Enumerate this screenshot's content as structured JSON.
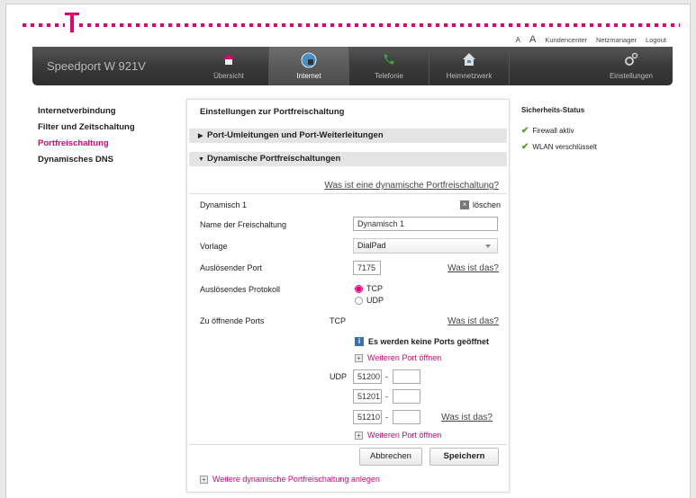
{
  "top": {
    "font_small": "A",
    "font_large": "A",
    "links": [
      "Kundencenter",
      "Netzmanager",
      "Logout"
    ]
  },
  "nav": {
    "brand": "Speedport W 921V",
    "tabs": [
      {
        "label": "Übersicht",
        "icon": "home-icon"
      },
      {
        "label": "Internet",
        "icon": "globe-icon",
        "active": true
      },
      {
        "label": "Telefonie",
        "icon": "phone-icon"
      },
      {
        "label": "Heimnetzwerk",
        "icon": "house-network-icon"
      },
      {
        "label": "Einstellungen",
        "icon": "gears-icon"
      }
    ]
  },
  "sidebar": {
    "items": [
      {
        "label": "Internetverbindung"
      },
      {
        "label": "Filter und Zeitschaltung"
      },
      {
        "label": "Portfreischaltung",
        "active": true
      },
      {
        "label": "Dynamisches DNS"
      }
    ]
  },
  "main": {
    "title": "Einstellungen zur Portfreischaltung",
    "acc1": "Port-Umleitungen und Port-Weiterleitungen",
    "acc2": "Dynamische Portfreischaltungen",
    "what_dynamic": "Was ist eine dynamische Portfreischaltung?",
    "entry_title": "Dynamisch 1",
    "delete": "löschen",
    "name_label": "Name der Freischaltung",
    "name_value": "Dynamisch 1",
    "template_label": "Vorlage",
    "template_value": "DialPad",
    "trigger_port_label": "Auslösender Port",
    "trigger_port_value": "7175",
    "what_is": "Was ist das?",
    "protocol_label": "Auslösendes Protokoll",
    "protocol_tcp": "TCP",
    "protocol_udp": "UDP",
    "ports_label": "Zu öffnende Ports",
    "tcp_label": "TCP",
    "udp_label": "UDP",
    "no_ports": "Es werden keine Ports geöffnet",
    "more_port": "Weiteren Port öffnen",
    "udp_ports": [
      {
        "from": "51200",
        "sep": "-",
        "to": ""
      },
      {
        "from": "51201",
        "sep": "-",
        "to": ""
      },
      {
        "from": "51210",
        "sep": "-",
        "to": ""
      }
    ],
    "cancel": "Abbrechen",
    "save": "Speichern",
    "add_dynamic": "Weitere dynamische Portfreischaltung anlegen"
  },
  "status": {
    "title": "Sicherheits-Status",
    "items": [
      "Firewall aktiv",
      "WLAN verschlüsselt"
    ]
  },
  "colors": {
    "accent": "#e20074",
    "ok": "#5a9a2a"
  }
}
